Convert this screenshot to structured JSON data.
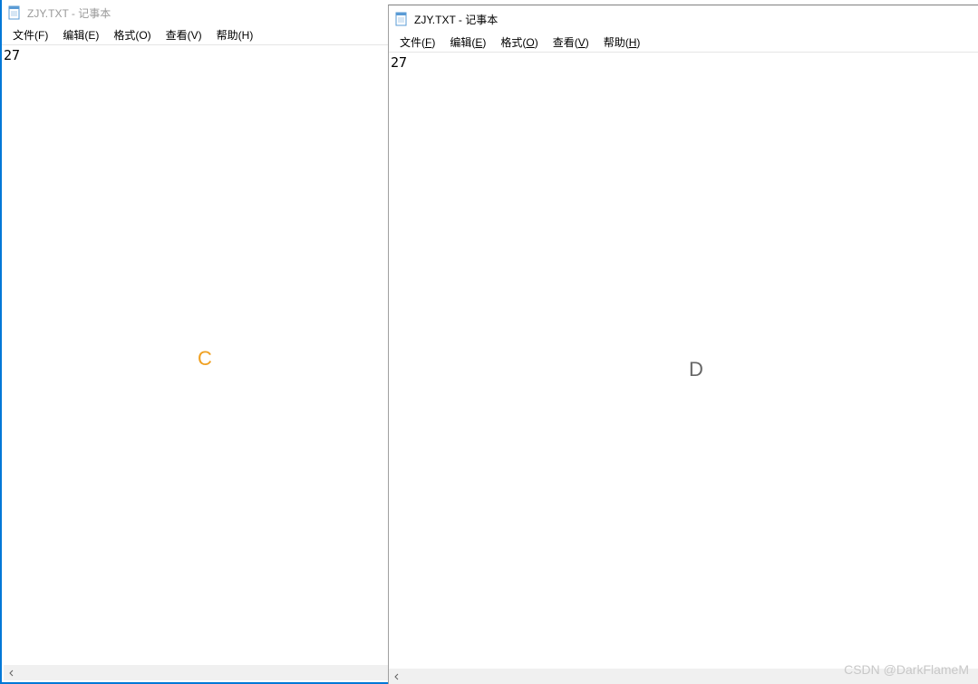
{
  "left_window": {
    "title": "ZJY.TXT - 记事本",
    "menus": {
      "file": "文件(F)",
      "edit": "编辑(E)",
      "format": "格式(O)",
      "view": "查看(V)",
      "help": "帮助(H)"
    },
    "content": "27",
    "center_label": "C"
  },
  "right_window": {
    "title": "ZJY.TXT - 记事本",
    "menus": {
      "file": "文件(F)",
      "edit": "编辑(E)",
      "format": "格式(O)",
      "view": "查看(V)",
      "help": "帮助(H)"
    },
    "content": "27",
    "center_label": "D"
  },
  "watermark": "CSDN @DarkFlameM"
}
